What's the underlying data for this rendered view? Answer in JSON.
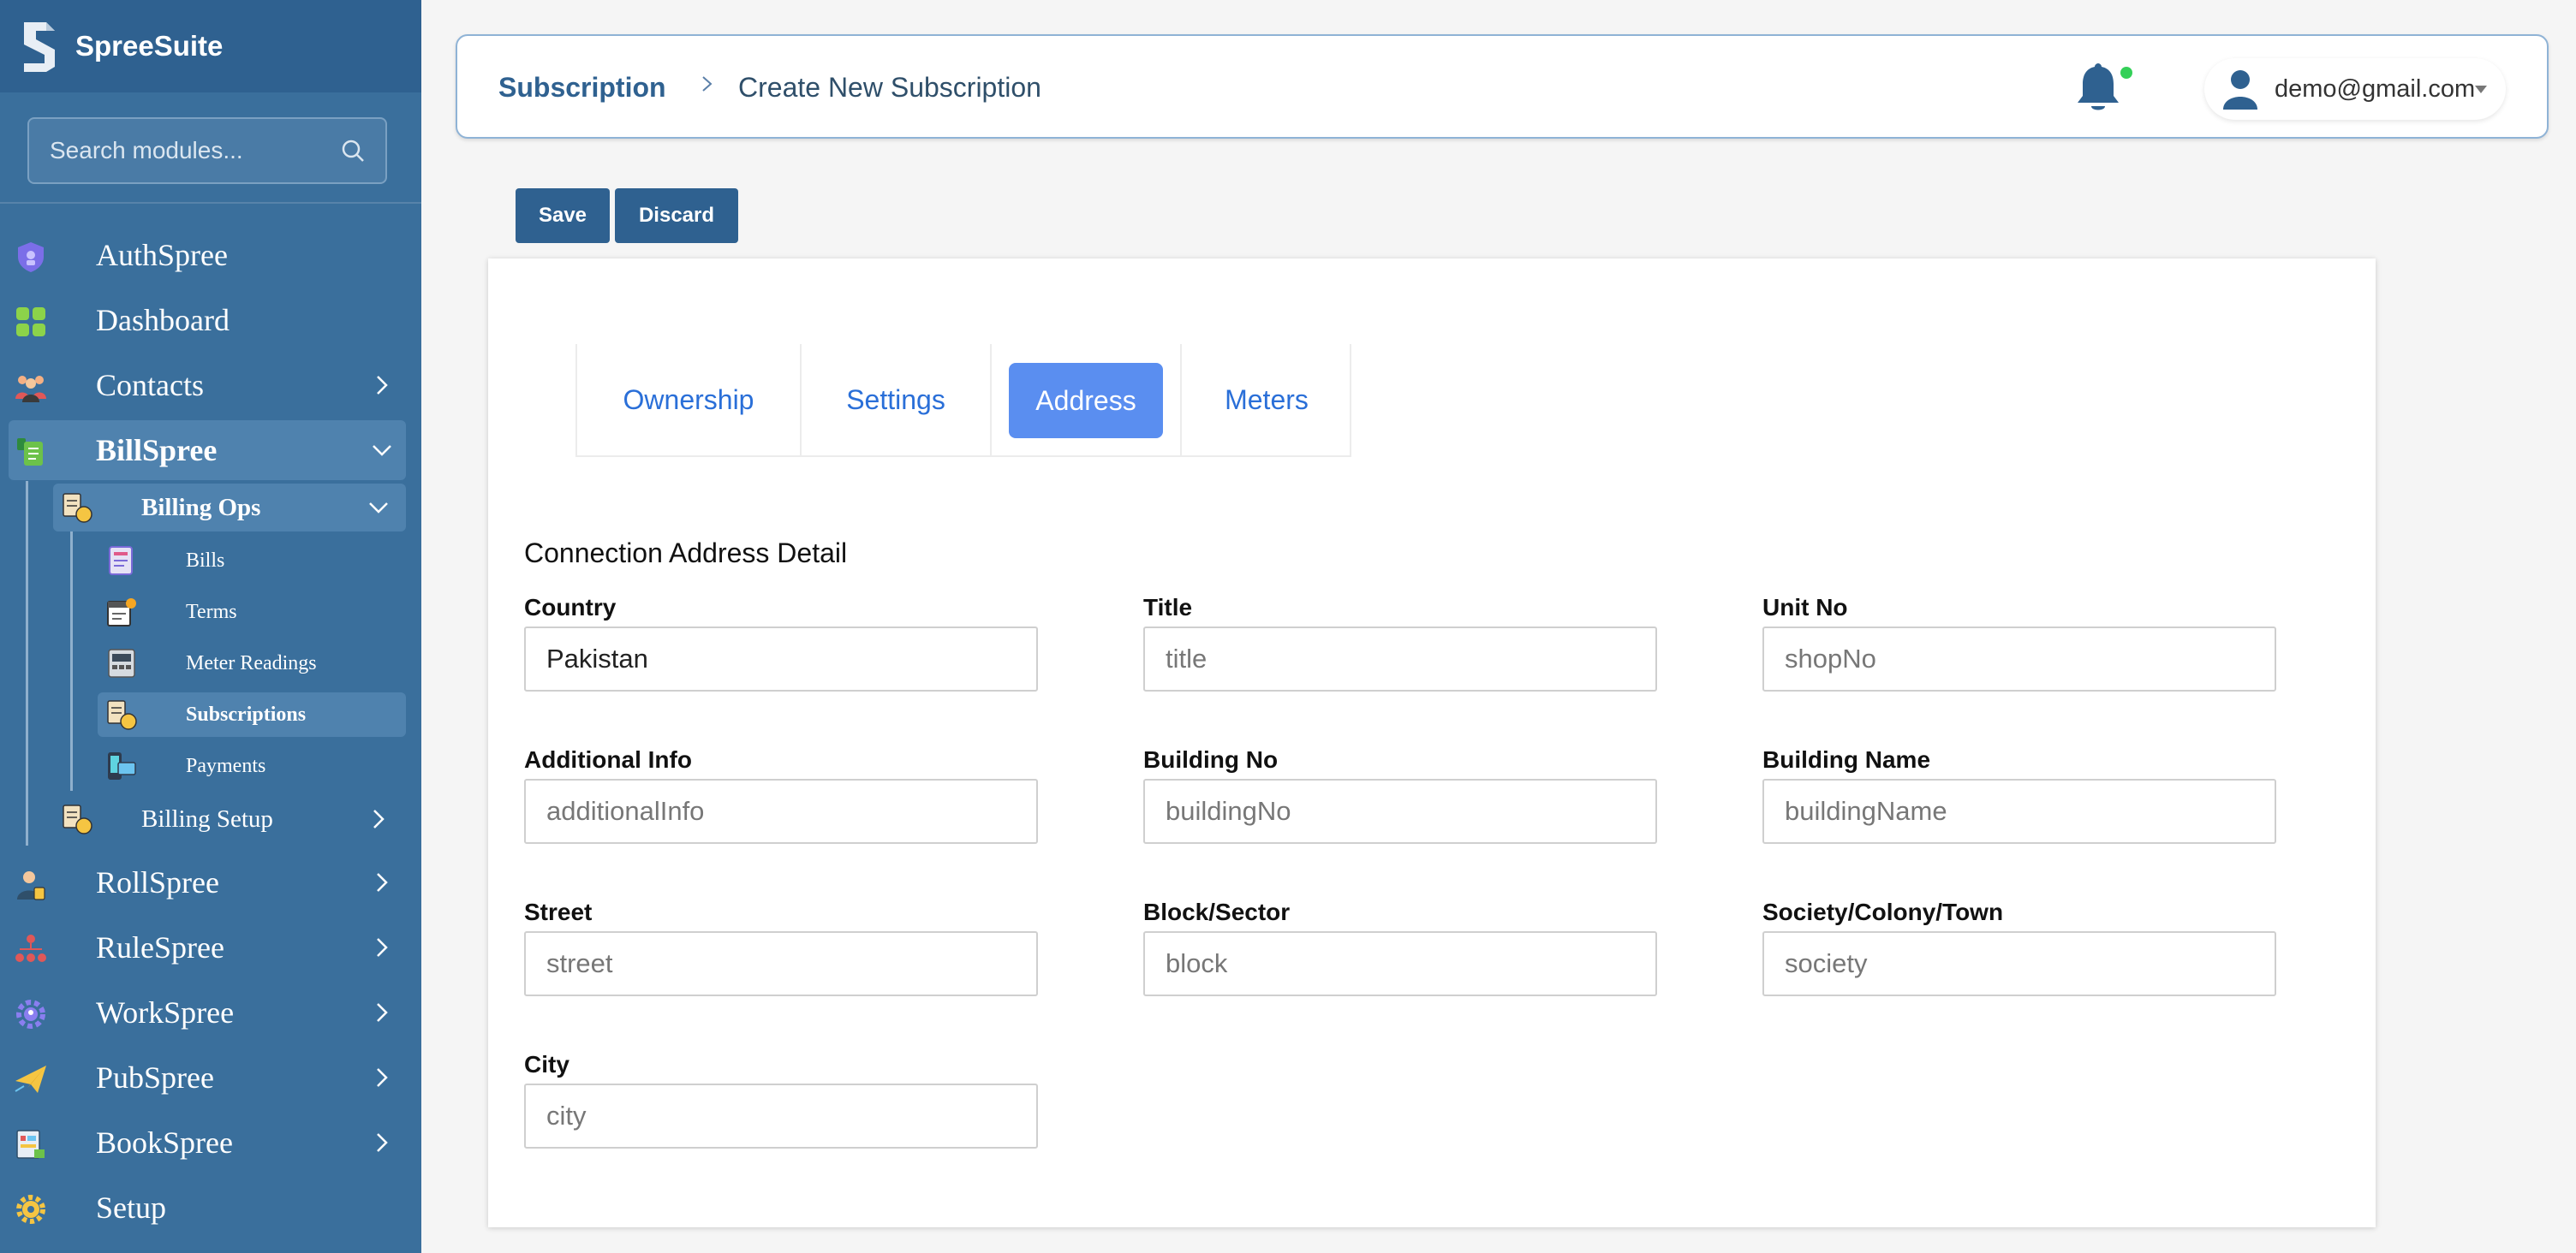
{
  "app": {
    "name": "SpreeSuite"
  },
  "sidebar": {
    "search_placeholder": "Search modules...",
    "items": [
      {
        "label": "AuthSpree",
        "icon": "shield-icon"
      },
      {
        "label": "Dashboard",
        "icon": "dashboard-grid-icon"
      },
      {
        "label": "Contacts",
        "icon": "people-group-icon"
      },
      {
        "label": "BillSpree",
        "icon": "bill-document-icon"
      },
      {
        "label": "RollSpree",
        "icon": "person-badge-icon"
      },
      {
        "label": "RuleSpree",
        "icon": "org-chart-icon"
      },
      {
        "label": "WorkSpree",
        "icon": "gear-people-icon"
      },
      {
        "label": "PubSpree",
        "icon": "paper-plane-icon"
      },
      {
        "label": "BookSpree",
        "icon": "ledger-icon"
      },
      {
        "label": "Setup",
        "icon": "settings-gear-icon"
      }
    ],
    "billing_ops": {
      "label": "Billing Ops",
      "children": [
        {
          "label": "Bills",
          "icon": "invoice-icon"
        },
        {
          "label": "Terms",
          "icon": "calendar-doc-icon"
        },
        {
          "label": "Meter Readings",
          "icon": "meter-icon"
        },
        {
          "label": "Subscriptions",
          "icon": "subscription-icon"
        },
        {
          "label": "Payments",
          "icon": "payment-card-icon"
        }
      ]
    },
    "billing_setup": {
      "label": "Billing Setup"
    }
  },
  "header": {
    "breadcrumb_root": "Subscription",
    "breadcrumb_current": "Create New Subscription",
    "user_email": "demo@gmail.com"
  },
  "actions": {
    "save": "Save",
    "discard": "Discard"
  },
  "tabs": [
    "Ownership",
    "Settings",
    "Address",
    "Meters"
  ],
  "form": {
    "section_title": "Connection Address Detail",
    "country": {
      "label": "Country",
      "value": "Pakistan"
    },
    "title": {
      "label": "Title",
      "placeholder": "title"
    },
    "unit_no": {
      "label": "Unit No",
      "placeholder": "shopNo"
    },
    "additional_info": {
      "label": "Additional Info",
      "placeholder": "additionalInfo"
    },
    "building_no": {
      "label": "Building No",
      "placeholder": "buildingNo"
    },
    "building_name": {
      "label": "Building Name",
      "placeholder": "buildingName"
    },
    "street": {
      "label": "Street",
      "placeholder": "street"
    },
    "block": {
      "label": "Block/Sector",
      "placeholder": "block"
    },
    "society": {
      "label": "Society/Colony/Town",
      "placeholder": "society"
    },
    "city": {
      "label": "City",
      "placeholder": "city"
    }
  }
}
